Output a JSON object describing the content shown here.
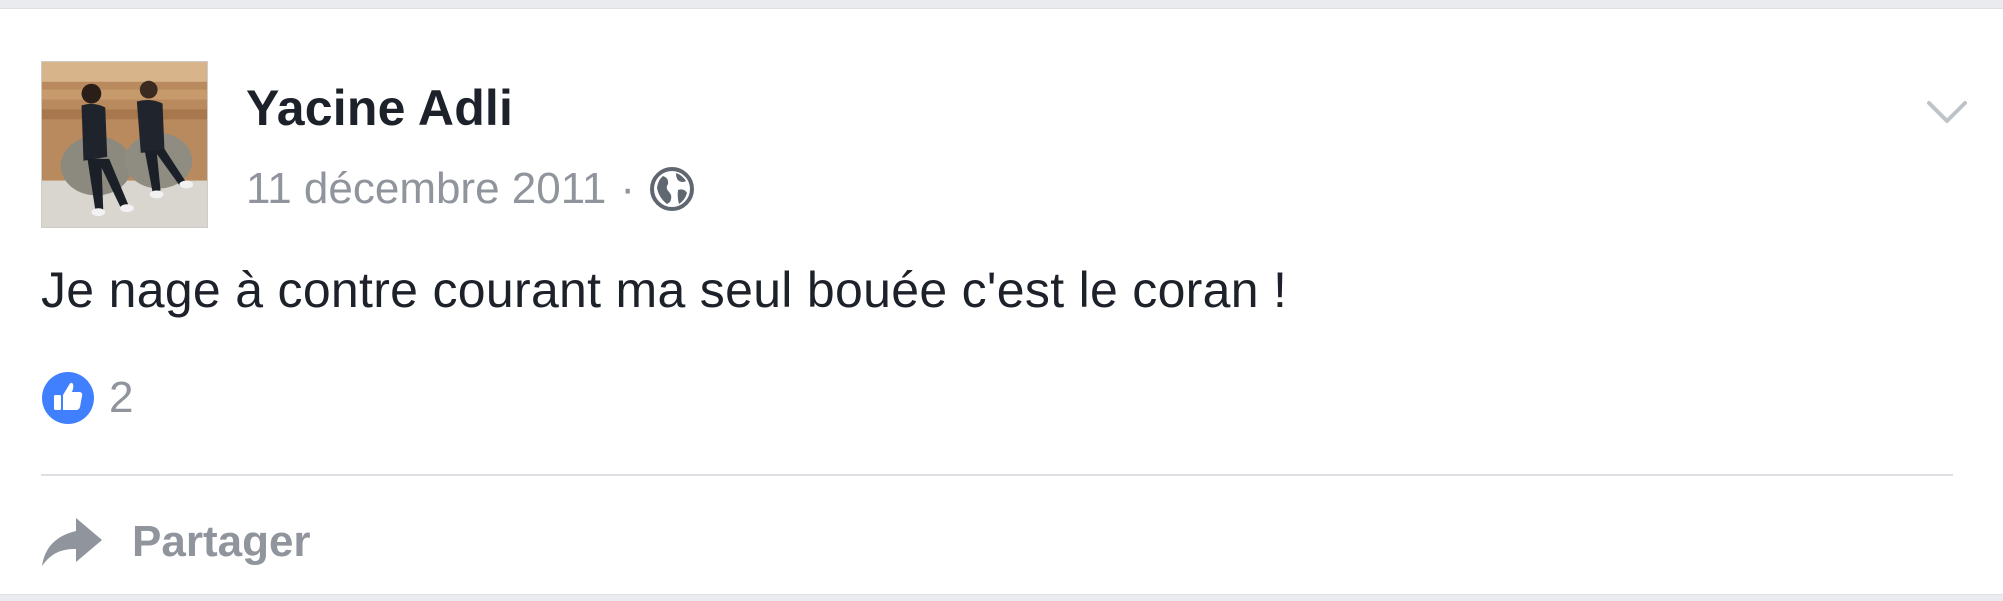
{
  "post": {
    "author_name": "Yacine Adli",
    "date": "11 décembre 2011",
    "separator": "·",
    "privacy_icon": "globe-icon",
    "body_text": "Je nage à contre courant ma seul bouée c'est le coran !",
    "options_icon": "chevron-down-icon"
  },
  "reactions": {
    "like_icon": "thumbs-up-icon",
    "like_count": "2"
  },
  "actions": {
    "share_icon": "share-arrow-icon",
    "share_label": "Partager"
  },
  "colors": {
    "author_text": "#1d2129",
    "meta_text": "#90949c",
    "like_blue": "#4080ff",
    "divider": "#dddfe2"
  }
}
